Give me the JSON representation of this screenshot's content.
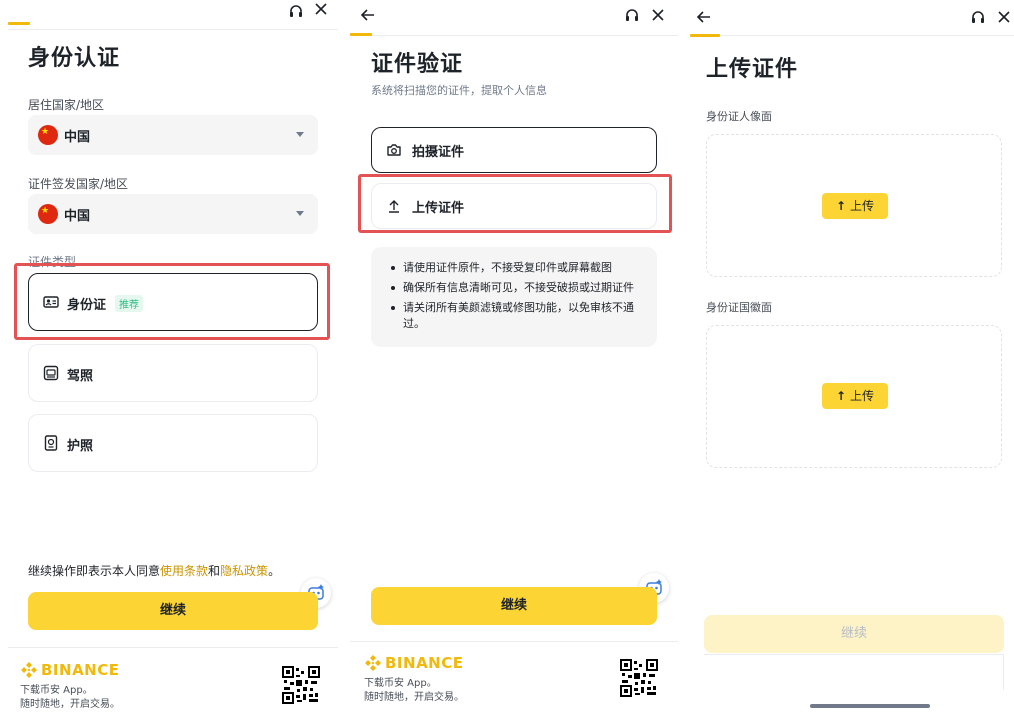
{
  "panel1": {
    "title": "身份认证",
    "residence_label": "居住国家/地区",
    "residence_value": "中国",
    "issuing_label": "证件签发国家/地区",
    "issuing_value": "中国",
    "doctype_label": "证件类型",
    "options": [
      {
        "label": "身份证",
        "badge": "推荐",
        "icon": "id-card-icon"
      },
      {
        "label": "驾照",
        "icon": "driver-license-icon"
      },
      {
        "label": "护照",
        "icon": "passport-icon"
      }
    ],
    "agree_prefix": "继续操作即表示本人同意",
    "terms_link": "使用条款",
    "agree_and": "和",
    "privacy_link": "隐私政策",
    "agree_suffix": "。",
    "continue_label": "继续"
  },
  "panel2": {
    "title": "证件验证",
    "subtitle": "系统将扫描您的证件，提取个人信息",
    "option_camera": "拍摄证件",
    "option_upload": "上传证件",
    "tips": [
      "请使用证件原件，不接受复印件或屏幕截图",
      "确保所有信息清晰可见，不接受破损或过期证件",
      "请关闭所有美颜滤镜或修图功能，以免审核不通",
      "过。"
    ],
    "continue_label": "继续"
  },
  "panel3": {
    "title": "上传证件",
    "front_label": "身份证人像面",
    "back_label": "身份证国徽面",
    "upload_label": "上传",
    "continue_label": "继续"
  },
  "footer": {
    "brand": "BINANCE",
    "line1": "下载币安 App。",
    "line2": "随时随地，开启交易。"
  },
  "colors": {
    "accent": "#fcd535",
    "brand": "#f0b90b",
    "highlight": "#e35353",
    "badge_green": "#2ebd85"
  }
}
